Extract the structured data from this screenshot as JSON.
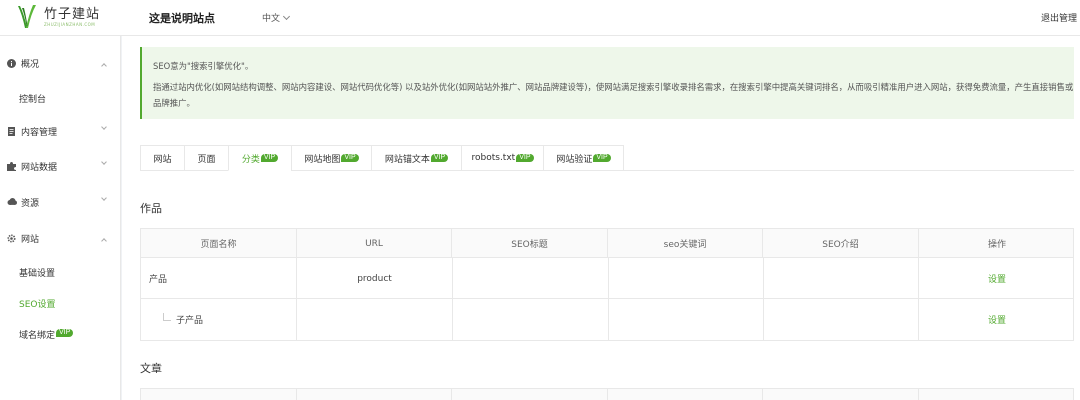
{
  "header": {
    "logo_title": "竹子建站",
    "logo_subtitle": "ZHUZIJIANZHAN.COM",
    "site_name": "这是说明站点",
    "language": "中文",
    "logout": "退出管理"
  },
  "sidebar": {
    "overview": "概况",
    "dashboard": "控制台",
    "content": "内容管理",
    "data": "网站数据",
    "resources": "资源",
    "site": "网站",
    "basic_settings": "基础设置",
    "seo_settings": "SEO设置",
    "domain_binding": "域名绑定",
    "vip": "VIP"
  },
  "notice": {
    "line1": "SEO意为\"搜索引擎优化\"。",
    "line2": "指通过站内优化(如网站结构调整、网站内容建设、网站代码优化等) 以及站外优化(如网站站外推广、网站品牌建设等)，使网站满足搜索引擎收录排名需求，在搜索引擎中提高关键词排名，从而吸引精准用户进入网站，获得免费流量，产生直接销售或品牌推广。"
  },
  "tabs": [
    {
      "label": "网站",
      "vip": ""
    },
    {
      "label": "页面",
      "vip": ""
    },
    {
      "label": "分类",
      "vip": "VIP"
    },
    {
      "label": "网站地图",
      "vip": "VIP"
    },
    {
      "label": "网站锚文本",
      "vip": "VIP"
    },
    {
      "label": "robots.txt",
      "vip": "VIP"
    },
    {
      "label": "网站验证",
      "vip": "VIP"
    }
  ],
  "sections": {
    "works": "作品",
    "articles": "文章"
  },
  "table": {
    "headers": [
      "页面名称",
      "URL",
      "SEO标题",
      "seo关键词",
      "SEO介绍",
      "操作"
    ],
    "rows": [
      {
        "name": "产品",
        "url": "product",
        "title": "",
        "keywords": "",
        "desc": "",
        "action": "设置"
      },
      {
        "name": "子产品",
        "url": "",
        "title": "",
        "keywords": "",
        "desc": "",
        "action": "设置"
      }
    ]
  },
  "colors": {
    "accent": "#52a92f",
    "notice_bg": "#eef7ea"
  }
}
